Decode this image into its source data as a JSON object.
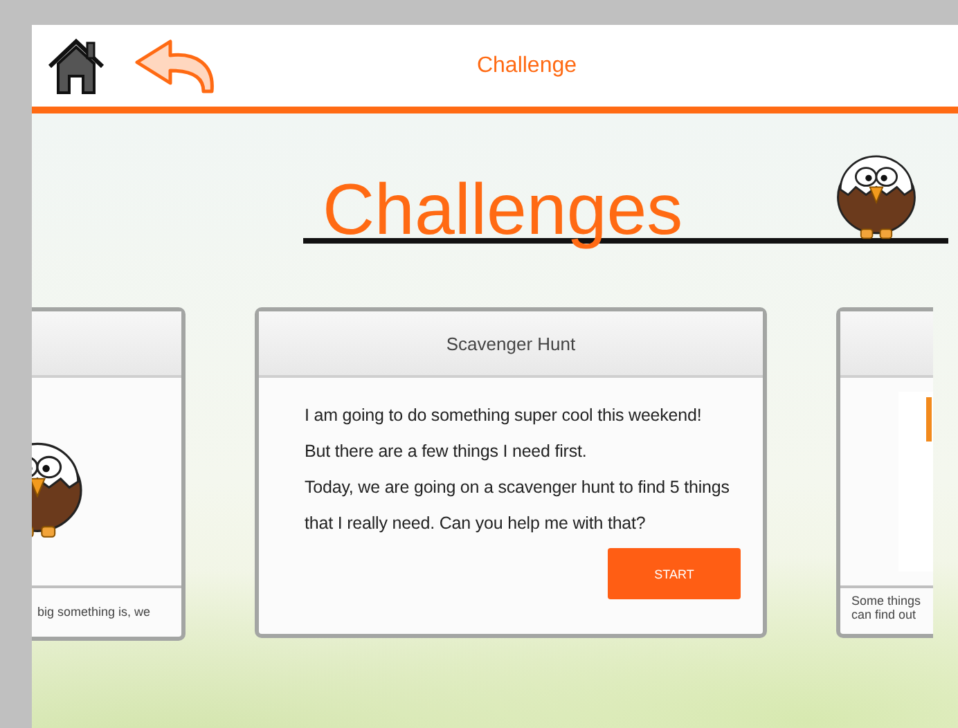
{
  "header": {
    "title": "Challenge"
  },
  "page_title": "Challenges",
  "cards": [
    {
      "kind": "partial-left",
      "footer_lines": [
        "big something is, we"
      ]
    },
    {
      "kind": "full",
      "title": "Scavenger Hunt",
      "lines": [
        "I am going to do something super cool this weekend!",
        "But there are a few things I need first.",
        "Today, we are going on a scavenger hunt to find 5 things",
        "that I really need. Can you help me with that?"
      ],
      "button": "START"
    },
    {
      "kind": "partial-right",
      "footer_lines": [
        "Some things",
        "can find out"
      ]
    }
  ]
}
